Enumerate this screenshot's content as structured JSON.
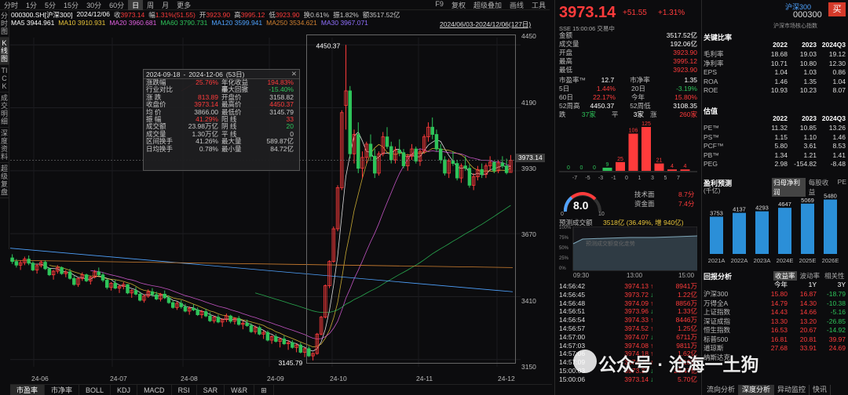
{
  "topbar": {
    "timeframes": [
      "分时",
      "1分",
      "5分",
      "15分",
      "30分",
      "60分",
      "日",
      "周",
      "月",
      "更多"
    ],
    "active_index": 6,
    "right": [
      "F9",
      "复权",
      "超级叠加",
      "画线",
      "工具"
    ]
  },
  "leftstrip": [
    "分时图",
    "K线图",
    "TICK",
    "成交明细",
    "深度资料",
    "超级复盘"
  ],
  "info1": {
    "code": "000300.SH[沪深300]",
    "date": "2024/12/06",
    "close_label": "收",
    "close": "3973.14",
    "chg_label": "幅",
    "chg": "1.31%(51.55)",
    "open_label": "开",
    "open": "3923.90",
    "high_label": "高",
    "high": "3995.12",
    "low_label": "低",
    "low": "3923.90",
    "turnover_label": "换",
    "turnover": "0.61%",
    "amp_label": "振",
    "amp": "1.82%",
    "amount_label": "额",
    "amount": "3517.52亿"
  },
  "info2": {
    "ma5": "MA5 3944.961",
    "ma10": "MA10 3910.931",
    "ma20": "MA20 3960.681",
    "ma60": "MA60 3790.731",
    "ma120": "MA120 3599.941",
    "ma250": "MA250 3534.621",
    "ma30": "MA30 3967.071",
    "date_range": "2024/06/03-2024/12/06(127日)"
  },
  "stats_popup": {
    "start": "2024-09-18",
    "end": "2024-12-06",
    "days": "(53日)",
    "sep": "-",
    "close_icon": "✕",
    "rows": [
      {
        "k1": "涨跌幅",
        "v1": "25.76%",
        "k2": "年化收益率",
        "v2": "194.83%"
      },
      {
        "k1": "行业对比",
        "v1": "",
        "k2": "最大回撤",
        "v2": "-15.40%"
      },
      {
        "k1": "涨  跌",
        "v1": "813.89",
        "k2": "开盘价",
        "v2": "3158.82"
      },
      {
        "k1": "收盘价",
        "v1": "3973.14",
        "k2": "最高价",
        "v2": "4450.37"
      },
      {
        "k1": "均  价",
        "v1": "3866.00",
        "k2": "最低价",
        "v2": "3145.79"
      },
      {
        "k1": "振  幅",
        "v1": "41.29%",
        "k2": "阳  线",
        "v2": "33"
      },
      {
        "k1": "成交额",
        "v1": "23.98万亿",
        "k2": "阴  线",
        "v2": "20"
      },
      {
        "k1": "成交量",
        "v1": "1.30万亿",
        "k2": "平  线",
        "v2": "0"
      },
      {
        "k1": "区间换手",
        "v1": "41.26%",
        "k2": "最大量",
        "v2": "589.87亿"
      },
      {
        "k1": "日均换手",
        "v1": "0.78%",
        "k2": "最小量",
        "v2": "84.72亿"
      }
    ]
  },
  "chart_data": {
    "type": "candlestick",
    "x_labels": [
      "24-06",
      "24-07",
      "24-08",
      "24-09",
      "24-10",
      "24-11",
      "24-12"
    ],
    "y_ticks": [
      "4450",
      "4190",
      "3930",
      "3670",
      "3410",
      "3150"
    ],
    "ylim": [
      3120,
      4480
    ],
    "current_price": "3973.14",
    "high_mark": "4450.37",
    "low_mark": "3145.79",
    "candles": [
      [
        3570,
        3585,
        3545,
        3555
      ],
      [
        3555,
        3565,
        3530,
        3540
      ],
      [
        3540,
        3560,
        3520,
        3550
      ],
      [
        3550,
        3575,
        3540,
        3565
      ],
      [
        3565,
        3580,
        3540,
        3548
      ],
      [
        3548,
        3555,
        3515,
        3520
      ],
      [
        3520,
        3545,
        3505,
        3538
      ],
      [
        3538,
        3560,
        3530,
        3552
      ],
      [
        3552,
        3560,
        3520,
        3525
      ],
      [
        3525,
        3530,
        3495,
        3500
      ],
      [
        3500,
        3520,
        3480,
        3515
      ],
      [
        3515,
        3540,
        3505,
        3530
      ],
      [
        3530,
        3535,
        3500,
        3505
      ],
      [
        3505,
        3520,
        3490,
        3512
      ],
      [
        3512,
        3525,
        3480,
        3485
      ],
      [
        3485,
        3495,
        3455,
        3460
      ],
      [
        3460,
        3490,
        3450,
        3485
      ],
      [
        3485,
        3510,
        3475,
        3500
      ],
      [
        3500,
        3505,
        3470,
        3475
      ],
      [
        3475,
        3495,
        3460,
        3490
      ],
      [
        3490,
        3520,
        3485,
        3512
      ],
      [
        3512,
        3530,
        3495,
        3500
      ],
      [
        3500,
        3510,
        3470,
        3478
      ],
      [
        3478,
        3485,
        3440,
        3448
      ],
      [
        3448,
        3470,
        3435,
        3465
      ],
      [
        3465,
        3480,
        3440,
        3445
      ],
      [
        3445,
        3460,
        3425,
        3452
      ],
      [
        3452,
        3470,
        3440,
        3460
      ],
      [
        3460,
        3462,
        3420,
        3425
      ],
      [
        3425,
        3440,
        3405,
        3435
      ],
      [
        3435,
        3450,
        3415,
        3420
      ],
      [
        3420,
        3430,
        3390,
        3395
      ],
      [
        3395,
        3420,
        3385,
        3412
      ],
      [
        3412,
        3440,
        3405,
        3430
      ],
      [
        3430,
        3445,
        3410,
        3418
      ],
      [
        3418,
        3430,
        3395,
        3400
      ],
      [
        3400,
        3425,
        3390,
        3420
      ],
      [
        3420,
        3435,
        3400,
        3405
      ],
      [
        3405,
        3415,
        3380,
        3385
      ],
      [
        3385,
        3395,
        3360,
        3365
      ],
      [
        3365,
        3390,
        3355,
        3382
      ],
      [
        3382,
        3395,
        3360,
        3368
      ],
      [
        3368,
        3380,
        3345,
        3350
      ],
      [
        3350,
        3370,
        3335,
        3362
      ],
      [
        3362,
        3378,
        3350,
        3355
      ],
      [
        3355,
        3365,
        3330,
        3335
      ],
      [
        3335,
        3355,
        3320,
        3348
      ],
      [
        3348,
        3360,
        3325,
        3330
      ],
      [
        3330,
        3345,
        3305,
        3310
      ],
      [
        3310,
        3330,
        3300,
        3325
      ],
      [
        3325,
        3335,
        3300,
        3305
      ],
      [
        3305,
        3320,
        3285,
        3315
      ],
      [
        3315,
        3340,
        3305,
        3330
      ],
      [
        3330,
        3335,
        3300,
        3308
      ],
      [
        3308,
        3325,
        3295,
        3320
      ],
      [
        3320,
        3330,
        3290,
        3295
      ],
      [
        3295,
        3310,
        3275,
        3300
      ],
      [
        3300,
        3315,
        3285,
        3290
      ],
      [
        3290,
        3300,
        3260,
        3265
      ],
      [
        3265,
        3290,
        3255,
        3282
      ],
      [
        3282,
        3290,
        3250,
        3255
      ],
      [
        3255,
        3270,
        3235,
        3262
      ],
      [
        3262,
        3270,
        3225,
        3230
      ],
      [
        3230,
        3250,
        3215,
        3245
      ],
      [
        3245,
        3255,
        3220,
        3225
      ],
      [
        3225,
        3240,
        3200,
        3235
      ],
      [
        3235,
        3248,
        3210,
        3215
      ],
      [
        3215,
        3230,
        3190,
        3220
      ],
      [
        3220,
        3230,
        3195,
        3200
      ],
      [
        3200,
        3215,
        3180,
        3210
      ],
      [
        3210,
        3220,
        3175,
        3180
      ],
      [
        3180,
        3200,
        3160,
        3195
      ],
      [
        3195,
        3205,
        3160,
        3165
      ],
      [
        3165,
        3180,
        3146,
        3175
      ],
      [
        3175,
        3260,
        3170,
        3255
      ],
      [
        3255,
        3330,
        3250,
        3325
      ],
      [
        3325,
        3460,
        3320,
        3455
      ],
      [
        3455,
        3560,
        3445,
        3555
      ],
      [
        3555,
        3700,
        3550,
        3690
      ],
      [
        3690,
        3870,
        3680,
        3860
      ],
      [
        3860,
        4180,
        3850,
        4170
      ],
      [
        4200,
        4450,
        4100,
        4260
      ],
      [
        4260,
        4280,
        3980,
        4000
      ],
      [
        4000,
        4100,
        3960,
        4080
      ],
      [
        4080,
        4130,
        3920,
        3940
      ],
      [
        3940,
        4010,
        3900,
        3985
      ],
      [
        3985,
        4050,
        3960,
        4040
      ],
      [
        4040,
        4080,
        3970,
        3990
      ],
      [
        3990,
        4020,
        3900,
        3920
      ],
      [
        3920,
        4010,
        3910,
        4000
      ],
      [
        4000,
        4090,
        3990,
        4070
      ],
      [
        4070,
        4110,
        4020,
        4030
      ],
      [
        4030,
        4050,
        3960,
        3975
      ],
      [
        3975,
        4030,
        3960,
        4015
      ],
      [
        4015,
        4060,
        3990,
        4005
      ],
      [
        4005,
        4020,
        3940,
        3950
      ],
      [
        3950,
        4000,
        3930,
        3990
      ],
      [
        3990,
        4040,
        3975,
        4020
      ],
      [
        4020,
        4030,
        3960,
        3970
      ],
      [
        3970,
        4020,
        3950,
        4010
      ],
      [
        4010,
        4080,
        4000,
        4070
      ],
      [
        4070,
        4130,
        4050,
        4110
      ],
      [
        4110,
        4150,
        4060,
        4080
      ],
      [
        4080,
        4100,
        4010,
        4020
      ],
      [
        4020,
        4040,
        3960,
        3975
      ],
      [
        3975,
        3990,
        3910,
        3920
      ],
      [
        3920,
        3980,
        3900,
        3970
      ],
      [
        3970,
        4010,
        3950,
        3960
      ],
      [
        3960,
        3975,
        3890,
        3900
      ],
      [
        3900,
        3960,
        3880,
        3950
      ],
      [
        3950,
        3990,
        3930,
        3940
      ],
      [
        3940,
        3955,
        3860,
        3870
      ],
      [
        3870,
        3920,
        3850,
        3905
      ],
      [
        3905,
        3950,
        3890,
        3935
      ],
      [
        3935,
        3960,
        3900,
        3915
      ],
      [
        3915,
        3960,
        3900,
        3950
      ],
      [
        3950,
        3990,
        3930,
        3965
      ],
      [
        3965,
        3970,
        3920,
        3930
      ],
      [
        3930,
        3975,
        3920,
        3962
      ],
      [
        3962,
        3990,
        3940,
        3950
      ],
      [
        3950,
        3980,
        3915,
        3922
      ],
      [
        3923,
        3995,
        3923,
        3973
      ]
    ]
  },
  "bottom_tabs": [
    "市盈率",
    "市净率",
    "BOLL",
    "KDJ",
    "MACD",
    "RSI",
    "SAR",
    "W&R",
    "⊞"
  ],
  "quote": {
    "price": "3973.14",
    "change": "+51.55",
    "change_pct": "+1.31%",
    "sub": "SSE  15:00:06  交易中",
    "fields": [
      {
        "k": "金额",
        "v": "3517.52亿"
      },
      {
        "k": "成交量",
        "v": "192.06亿"
      },
      {
        "k": "开盘",
        "v": "3923.90"
      },
      {
        "k": "最高",
        "v": "3995.12"
      },
      {
        "k": "最低",
        "v": "3923.90"
      }
    ],
    "pe_label": "市盈率™",
    "pe": "12.7",
    "pb_label": "市净率",
    "pb": "1.35",
    "d5_label": "5日",
    "d5": "1.44%",
    "d20_label": "20日",
    "d20": "-3.19%",
    "d60_label": "60日",
    "d60": "22.17%",
    "ytd_label": "今年",
    "ytd": "15.80%",
    "h52_label": "52周高",
    "h52": "4450.37",
    "l52_label": "52周低",
    "l52": "3108.35",
    "down_label": "跌",
    "down": "37家",
    "flat_label": "平",
    "flat": "3家",
    "up_label": "涨",
    "up": "260家"
  },
  "dist": {
    "labels": [
      "-7",
      "-5",
      "-3",
      "-1",
      "0",
      "1",
      "3",
      "5",
      "7"
    ],
    "values": [
      0,
      0,
      0,
      9,
      25,
      106,
      125,
      21,
      4,
      4
    ],
    "bar_labels": [
      "0",
      "0",
      "0",
      "9",
      "25",
      "106",
      "125",
      "21",
      "4",
      "4"
    ]
  },
  "gauge": {
    "value": "8.0",
    "min": "0",
    "max": "10",
    "tech_label": "技术面",
    "tech": "8.7分",
    "fund_label": "资金面",
    "fund": "7.4分"
  },
  "flow": {
    "label": "预测成交额",
    "value": "3518亿 (36.49%, 增 940亿)",
    "watermark": "预测成交额变化走势",
    "times": [
      "09:30",
      "13:00",
      "15:00"
    ],
    "pcts": [
      "100%",
      "75%",
      "50%",
      "25%",
      "0%"
    ]
  },
  "ticks": [
    {
      "t": "14:56:42",
      "p": "3974.13",
      "d": "↑",
      "v": "8941万"
    },
    {
      "t": "14:56:45",
      "p": "3973.72",
      "d": "↓",
      "v": "1.22亿"
    },
    {
      "t": "14:56:48",
      "p": "3974.09",
      "d": "↑",
      "v": "8856万"
    },
    {
      "t": "14:56:51",
      "p": "3973.96",
      "d": "↓",
      "v": "1.33亿"
    },
    {
      "t": "14:56:54",
      "p": "3974.33",
      "d": "↑",
      "v": "8446万"
    },
    {
      "t": "14:56:57",
      "p": "3974.52",
      "d": "↑",
      "v": "1.25亿"
    },
    {
      "t": "14:57:00",
      "p": "3974.07",
      "d": "↓",
      "v": "6711万"
    },
    {
      "t": "14:57:03",
      "p": "3974.08",
      "d": "↑",
      "v": "9811万"
    },
    {
      "t": "14:57:06",
      "p": "3974.18",
      "d": "↑",
      "v": "1.62亿"
    },
    {
      "t": "14:57:09",
      "p": "3974.20",
      "d": "↑",
      "v": "7.10亿"
    },
    {
      "t": "15:00:03",
      "p": "3973.37",
      "d": "↓",
      "v": "26.47亿"
    },
    {
      "t": "15:00:06",
      "p": "3973.14",
      "d": "↓",
      "v": "5.70亿"
    }
  ],
  "far_right": {
    "title": "沪深300",
    "code": "000300",
    "buy": "买",
    "sub": "沪深市场核心指数",
    "ratio_title": "关键比率",
    "ratio_cols": [
      "2022",
      "2023",
      "2024Q3"
    ],
    "ratios": [
      {
        "k": "毛利率",
        "v": [
          "18.68",
          "19.03",
          "19.12"
        ]
      },
      {
        "k": "净利率",
        "v": [
          "10.71",
          "10.80",
          "12.30"
        ]
      },
      {
        "k": "EPS",
        "v": [
          "1.04",
          "1.03",
          "0.86"
        ]
      },
      {
        "k": "ROA",
        "v": [
          "1.46",
          "1.35",
          "1.04"
        ]
      },
      {
        "k": "ROE",
        "v": [
          "10.93",
          "10.23",
          "8.07"
        ]
      }
    ],
    "val_title": "估值",
    "val_cols": [
      "2022",
      "2023",
      "2024Q3"
    ],
    "vals": [
      {
        "k": "PE™",
        "v": [
          "11.32",
          "10.85",
          "13.26"
        ]
      },
      {
        "k": "PS™",
        "v": [
          "1.15",
          "1.10",
          "1.46"
        ]
      },
      {
        "k": "PCF™",
        "v": [
          "5.80",
          "3.61",
          "8.53"
        ]
      },
      {
        "k": "PB™",
        "v": [
          "1.34",
          "1.21",
          "1.41"
        ]
      },
      {
        "k": "PEG",
        "v": [
          "2.98",
          "-154.82",
          "-8.48"
        ]
      }
    ],
    "eps_title": "盈利预测",
    "eps_unit": "(千亿)",
    "eps_tabs": [
      "归母净利润",
      "每股收益",
      "PE"
    ],
    "eps_bars": [
      {
        "year": "2021A",
        "v": 3753
      },
      {
        "year": "2022A",
        "v": 4137
      },
      {
        "year": "2023A",
        "v": 4293
      },
      {
        "year": "2024E",
        "v": 4647
      },
      {
        "year": "2025E",
        "v": 5069
      },
      {
        "year": "2026E",
        "v": 5480
      }
    ],
    "ret_title": "回报分析",
    "ret_tabs": [
      "收益率",
      "波动率",
      "相关性"
    ],
    "ret_cols": [
      "今年",
      "1Y",
      "3Y"
    ],
    "rets": [
      {
        "k": "沪深300",
        "v": [
          "15.80",
          "16.87",
          "-18.79"
        ]
      },
      {
        "k": "万得全A",
        "v": [
          "14.79",
          "14.30",
          "-10.38"
        ]
      },
      {
        "k": "上证指数",
        "v": [
          "14.43",
          "14.66",
          "-5.16"
        ]
      },
      {
        "k": "深证成指",
        "v": [
          "13.30",
          "13.20",
          "-26.85"
        ]
      },
      {
        "k": "恒生指数",
        "v": [
          "16.53",
          "20.67",
          "-14.92"
        ]
      },
      {
        "k": "标普500",
        "v": [
          "16.81",
          "20.81",
          "39.97"
        ]
      },
      {
        "k": "道琼斯",
        "v": [
          "27.68",
          "33.91",
          "24.69"
        ]
      },
      {
        "k": "纳斯达克",
        "v": [
          "",
          "",
          ""
        ]
      }
    ],
    "bottom_tabs": [
      "流向分析",
      "深度分析",
      "异动监控",
      "快讯"
    ]
  },
  "watermark": "公众号 · 沧海一土狗",
  "colors": {
    "up": "#ff3b3b",
    "down": "#2ec45a",
    "bg": "#0c0c0e",
    "accent": "#4fa3ff"
  }
}
